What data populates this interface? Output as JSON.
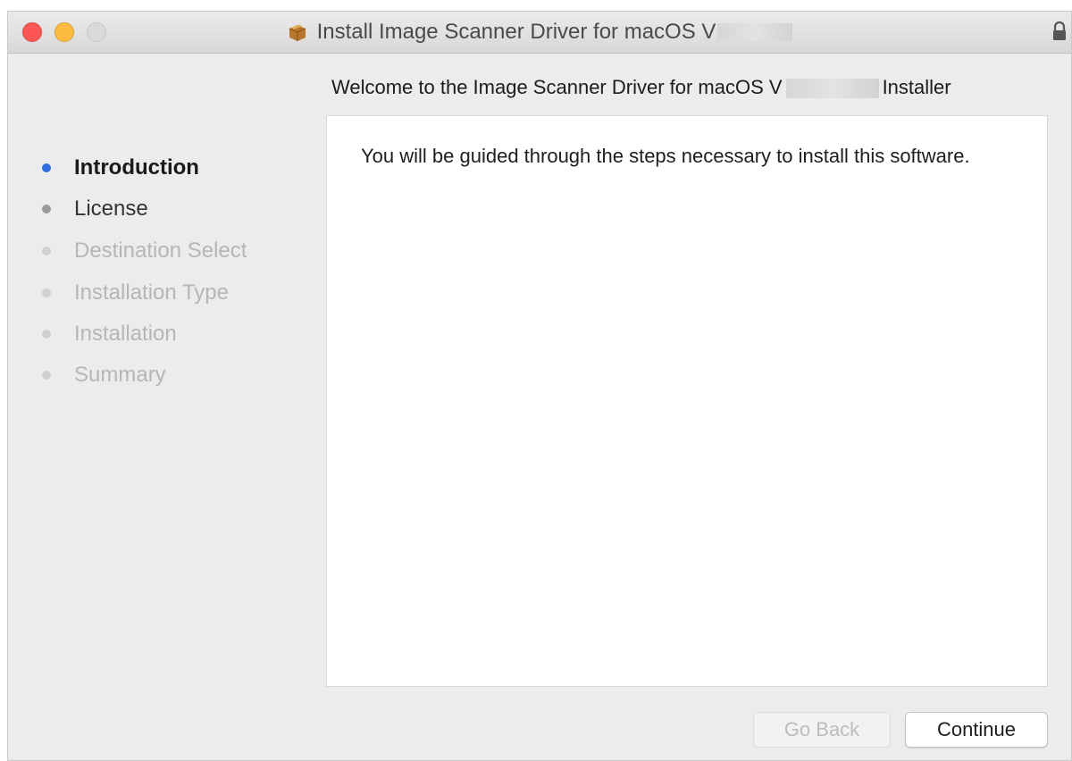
{
  "window": {
    "title": "Install Image Scanner Driver for macOS V",
    "heading_prefix": "Welcome to the Image Scanner Driver for macOS V",
    "heading_suffix": "Installer"
  },
  "sidebar": {
    "steps": [
      {
        "label": "Introduction",
        "state": "current"
      },
      {
        "label": "License",
        "state": "pending"
      },
      {
        "label": "Destination Select",
        "state": "disabled"
      },
      {
        "label": "Installation Type",
        "state": "disabled"
      },
      {
        "label": "Installation",
        "state": "disabled"
      },
      {
        "label": "Summary",
        "state": "disabled"
      }
    ]
  },
  "content": {
    "body": "You will be guided through the steps necessary to install this software."
  },
  "buttons": {
    "back_label": "Go Back",
    "continue_label": "Continue"
  },
  "colors": {
    "current_dot": "#2f6fe3",
    "pending_dot": "#9a9a9a",
    "disabled_dot": "#d0d0d0",
    "current_text": "#1a1a1a",
    "pending_text": "#333333",
    "disabled_text": "#b6b6b6",
    "close": "#fc5753",
    "minimize": "#fdbc40",
    "zoom_inactive": "#d9d9d9"
  },
  "icons": {
    "package": "package-icon",
    "lock": "lock-icon"
  }
}
